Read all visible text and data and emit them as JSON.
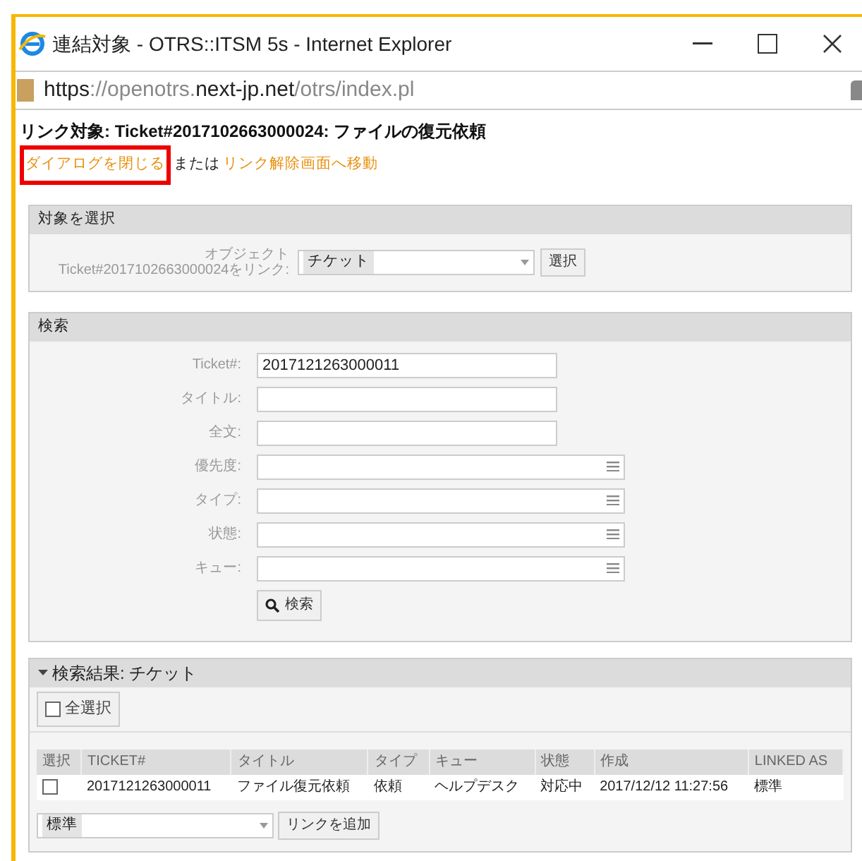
{
  "window": {
    "title": "連結対象 - OTRS::ITSM 5s - Internet Explorer"
  },
  "address_bar": {
    "segments": [
      {
        "text": "https",
        "highlighted": true
      },
      {
        "text": "://openotrs.",
        "highlighted": false
      },
      {
        "text": "next-jp.net",
        "highlighted": true
      },
      {
        "text": "/otrs/index.pl",
        "highlighted": false
      }
    ]
  },
  "heading": "リンク対象: Ticket#2017102663000024: ファイルの復元依頼",
  "links": {
    "close": {
      "label": "ダイアログを閉じる",
      "highlighted": true
    },
    "conjunction": "または",
    "unlink": {
      "label": "リンク解除画面へ移動",
      "highlighted": false
    }
  },
  "select_target": {
    "title": "対象を選択",
    "label_lines": [
      "オブジェクト",
      "Ticket#2017102663000024をリンク:"
    ],
    "value": "チケット",
    "button": "選択"
  },
  "search": {
    "title": "検索",
    "fields": [
      {
        "label": "Ticket#:",
        "kind": "text",
        "value": "2017121263000011"
      },
      {
        "label": "タイトル:",
        "kind": "text"
      },
      {
        "label": "全文:",
        "kind": "text"
      },
      {
        "label": "優先度:",
        "kind": "multiselect"
      },
      {
        "label": "タイプ:",
        "kind": "multiselect"
      },
      {
        "label": "状態:",
        "kind": "multiselect"
      },
      {
        "label": "キュー:",
        "kind": "multiselect"
      }
    ],
    "button": "検索"
  },
  "results": {
    "title": "検索結果: チケット",
    "expanded": true,
    "select_all": {
      "label": "全選択",
      "checked": false
    },
    "select_column": "選択",
    "columns": [
      "TICKET#",
      "タイトル",
      "タイプ",
      "キュー",
      "状態",
      "作成",
      "LINKED AS"
    ],
    "rows": [
      {
        "selected": false,
        "cells": [
          "2017121263000011",
          "ファイル復元依頼",
          "依頼",
          "ヘルプデスク",
          "対応中",
          "2017/12/12 11:27:56",
          "標準"
        ]
      }
    ],
    "link_type": "標準",
    "add_button": "リンクを追加"
  }
}
